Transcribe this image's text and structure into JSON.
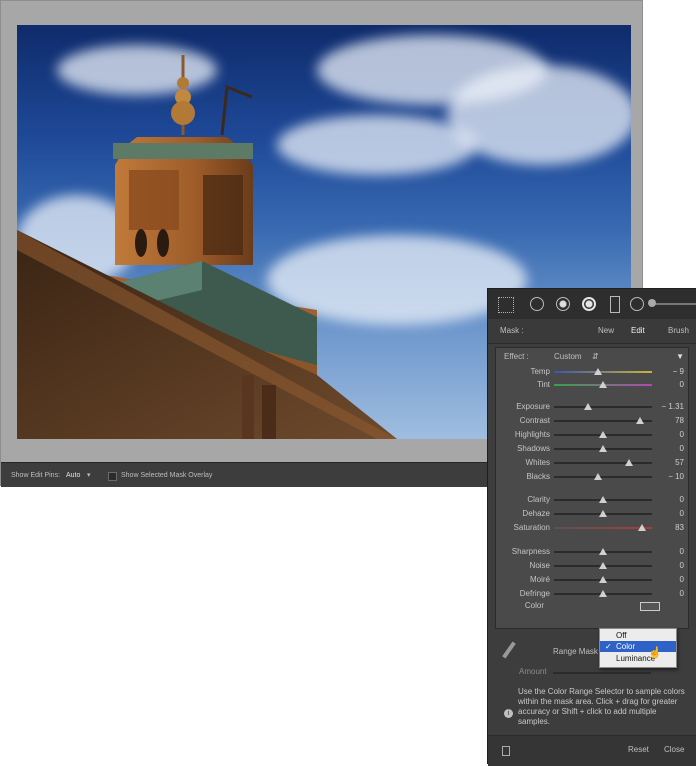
{
  "edit_bar": {
    "show_pins_label": "Show Edit Pins:",
    "show_pins_value": "Auto",
    "overlay_label": "Show Selected Mask Overlay"
  },
  "mask_header": {
    "label": "Mask :",
    "new": "New",
    "edit": "Edit",
    "brush": "Brush"
  },
  "effect": {
    "label": "Effect :",
    "value": "Custom"
  },
  "sliders": [
    {
      "label": "Temp",
      "value": "− 9",
      "pos": 0.45
    },
    {
      "label": "Tint",
      "value": "0",
      "pos": 0.5
    },
    {
      "label": "Exposure",
      "value": "− 1.31",
      "pos": 0.35
    },
    {
      "label": "Contrast",
      "value": "78",
      "pos": 0.88
    },
    {
      "label": "Highlights",
      "value": "0",
      "pos": 0.5
    },
    {
      "label": "Shadows",
      "value": "0",
      "pos": 0.5
    },
    {
      "label": "Whites",
      "value": "57",
      "pos": 0.77
    },
    {
      "label": "Blacks",
      "value": "− 10",
      "pos": 0.45
    },
    {
      "label": "Clarity",
      "value": "0",
      "pos": 0.5
    },
    {
      "label": "Dehaze",
      "value": "0",
      "pos": 0.5
    },
    {
      "label": "Saturation",
      "value": "83",
      "pos": 0.9
    },
    {
      "label": "Sharpness",
      "value": "0",
      "pos": 0.5
    },
    {
      "label": "Noise",
      "value": "0",
      "pos": 0.5
    },
    {
      "label": "Moiré",
      "value": "0",
      "pos": 0.5
    },
    {
      "label": "Defringe",
      "value": "0",
      "pos": 0.5
    }
  ],
  "color_label": "Color",
  "range_mask": {
    "label": "Range Mask",
    "amount_label": "Amount"
  },
  "dropdown": {
    "options": [
      "Off",
      "Color",
      "Luminance"
    ],
    "selected": "Color"
  },
  "help_text": "Use the Color Range Selector to sample colors within the mask area. Click + drag for greater accuracy or Shift + click to add multiple samples.",
  "bottom": {
    "reset": "Reset",
    "close": "Close"
  }
}
